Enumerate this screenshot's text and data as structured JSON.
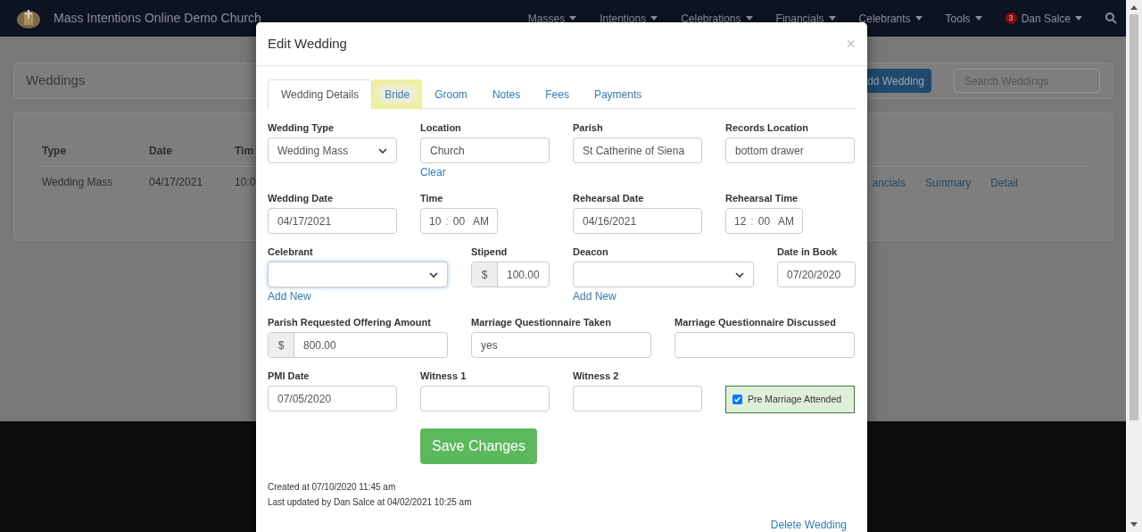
{
  "navbar": {
    "brand": "Mass Intentions Online Demo Church",
    "menus": [
      {
        "label": "Masses"
      },
      {
        "label": "Intentions"
      },
      {
        "label": "Celebrations"
      },
      {
        "label": "Financials"
      },
      {
        "label": "Celebrants"
      },
      {
        "label": "Tools"
      }
    ],
    "user": {
      "badge": "3",
      "name": "Dan Salce"
    }
  },
  "page": {
    "title": "Weddings",
    "add_button": "dd Wedding",
    "search": {
      "placeholder": "Search Weddings"
    },
    "table": {
      "columns": [
        "Type",
        "Date",
        "Tim"
      ],
      "rows": [
        [
          "Wedding Mass",
          "04/17/2021",
          "10:0"
        ]
      ]
    },
    "links": [
      "ancials",
      "Summary",
      "Detail"
    ]
  },
  "modal": {
    "title": "Edit Wedding",
    "close": "×",
    "tabs": [
      {
        "label": "Wedding Details",
        "selected": true,
        "hovered": false
      },
      {
        "label": "Bride",
        "selected": false,
        "hovered": true
      },
      {
        "label": "Groom",
        "selected": false,
        "hovered": false
      },
      {
        "label": "Notes",
        "selected": false,
        "hovered": false
      },
      {
        "label": "Fees",
        "selected": false,
        "hovered": false
      },
      {
        "label": "Payments",
        "selected": false,
        "hovered": false
      }
    ],
    "fields": [
      {
        "kind": "select",
        "label": "Wedding Type",
        "value": "Wedding Mass",
        "focused": false
      },
      {
        "kind": "text",
        "label": "Location",
        "value": "Church",
        "link": "Clear"
      },
      {
        "kind": "text",
        "label": "Parish",
        "value": "St Catherine of Siena"
      },
      {
        "kind": "text",
        "label": "Records Location",
        "value": "bottom drawer"
      },
      {
        "kind": "text",
        "label": "Wedding Date",
        "value": "04/17/2021"
      },
      {
        "kind": "time",
        "label": "Time",
        "hour": "10",
        "separator": ":",
        "minute": "00",
        "ampm": "AM"
      },
      {
        "kind": "text",
        "label": "Rehearsal Date",
        "value": "04/16/2021"
      },
      {
        "kind": "time",
        "label": "Rehearsal Time",
        "hour": "12",
        "separator": ":",
        "minute": "00",
        "ampm": "AM"
      },
      {
        "kind": "select",
        "label": "Celebrant",
        "focused": true,
        "link": "Add New"
      },
      {
        "kind": "addon",
        "label": "Stipend",
        "prefix": "$",
        "value": "100.00"
      },
      {
        "kind": "select",
        "label": "Deacon",
        "focused": false,
        "link": "Add New"
      },
      {
        "kind": "text",
        "label": "Date in Book",
        "value": "07/20/2020"
      },
      {
        "kind": "addon",
        "label": "Parish Requested Offering Amount",
        "prefix": "$",
        "value": "800.00"
      },
      {
        "kind": "text",
        "label": "Marriage Questionnaire Taken",
        "value": "yes"
      },
      {
        "kind": "text",
        "label": "Marriage Questionnaire Discussed"
      },
      {
        "kind": "text",
        "label": "PMI Date",
        "value": "07/05/2020"
      },
      {
        "kind": "text",
        "label": "Witness 1"
      },
      {
        "kind": "text",
        "label": "Witness 2"
      },
      {
        "kind": "checkbox",
        "label": "Pre Marriage Attended",
        "checked": true
      }
    ],
    "save": "Save Changes",
    "created": "Created at 07/10/2020 11:45 am",
    "updated": "Last updated by Dan Salce at 04/02/2021 10:25 am",
    "delete": "Delete Wedding"
  }
}
